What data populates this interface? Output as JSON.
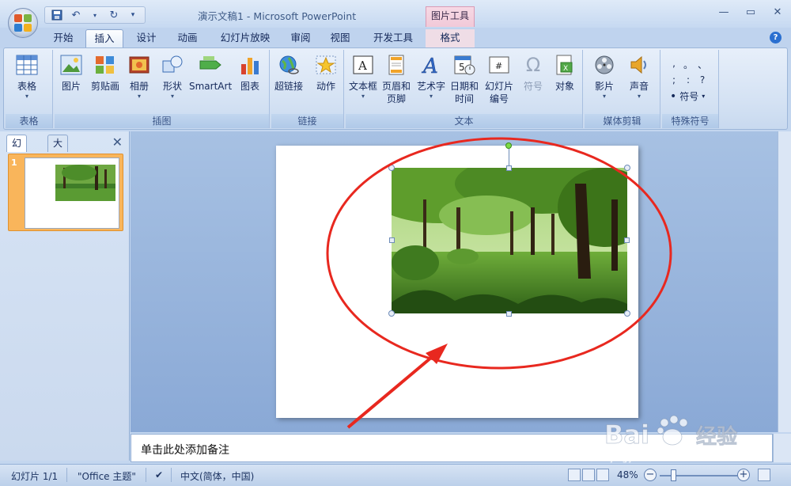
{
  "app": {
    "title": "演示文稿1 - Microsoft PowerPoint",
    "context_tab_header": "图片工具"
  },
  "qat": {
    "save_icon": "save-icon",
    "undo_icon": "undo-icon",
    "redo_icon": "redo-icon",
    "customize": "▾"
  },
  "tabs": [
    {
      "label": "开始"
    },
    {
      "label": "插入"
    },
    {
      "label": "设计"
    },
    {
      "label": "动画"
    },
    {
      "label": "幻灯片放映"
    },
    {
      "label": "审阅"
    },
    {
      "label": "视图"
    },
    {
      "label": "开发工具"
    },
    {
      "label": "格式"
    }
  ],
  "ribbon": {
    "groups": {
      "table": "表格",
      "illustrations": "插图",
      "links": "链接",
      "text": "文本",
      "media": "媒体剪辑",
      "symbols": "特殊符号"
    },
    "buttons": {
      "table": "表格",
      "picture": "图片",
      "clipart": "剪贴画",
      "album": "相册",
      "shapes": "形状",
      "smartart": "SmartArt",
      "chart": "图表",
      "hyperlink": "超链接",
      "action": "动作",
      "textbox": "文本框",
      "header_footer_1": "页眉和",
      "header_footer_2": "页脚",
      "wordart": "艺术字",
      "datetime_1": "日期和",
      "datetime_2": "时间",
      "slidenum_1": "幻灯片",
      "slidenum_2": "编号",
      "symbol": "符号",
      "object": "对象",
      "movie": "影片",
      "sound": "声音",
      "special_symbol": "符号"
    },
    "symbols": [
      ",",
      "。",
      "、",
      ";",
      ":",
      "?"
    ]
  },
  "leftpane": {
    "tab_slides": "幻灯片",
    "tab_outline": "大纲",
    "close": "✕",
    "slide_number": "1"
  },
  "notes": {
    "placeholder": "单击此处添加备注"
  },
  "statusbar": {
    "slide": "幻灯片 1/1",
    "theme": "\"Office 主题\"",
    "language": "中文(简体，中国)",
    "zoom": "48%"
  },
  "watermark": {
    "brand": "Bai",
    "suffix": "经验",
    "url": "jingyan.baidu.com"
  },
  "colors": {
    "accent": "#e8281f",
    "ribbon": "#d3e1f3",
    "active_thumb": "#f9b55b"
  }
}
